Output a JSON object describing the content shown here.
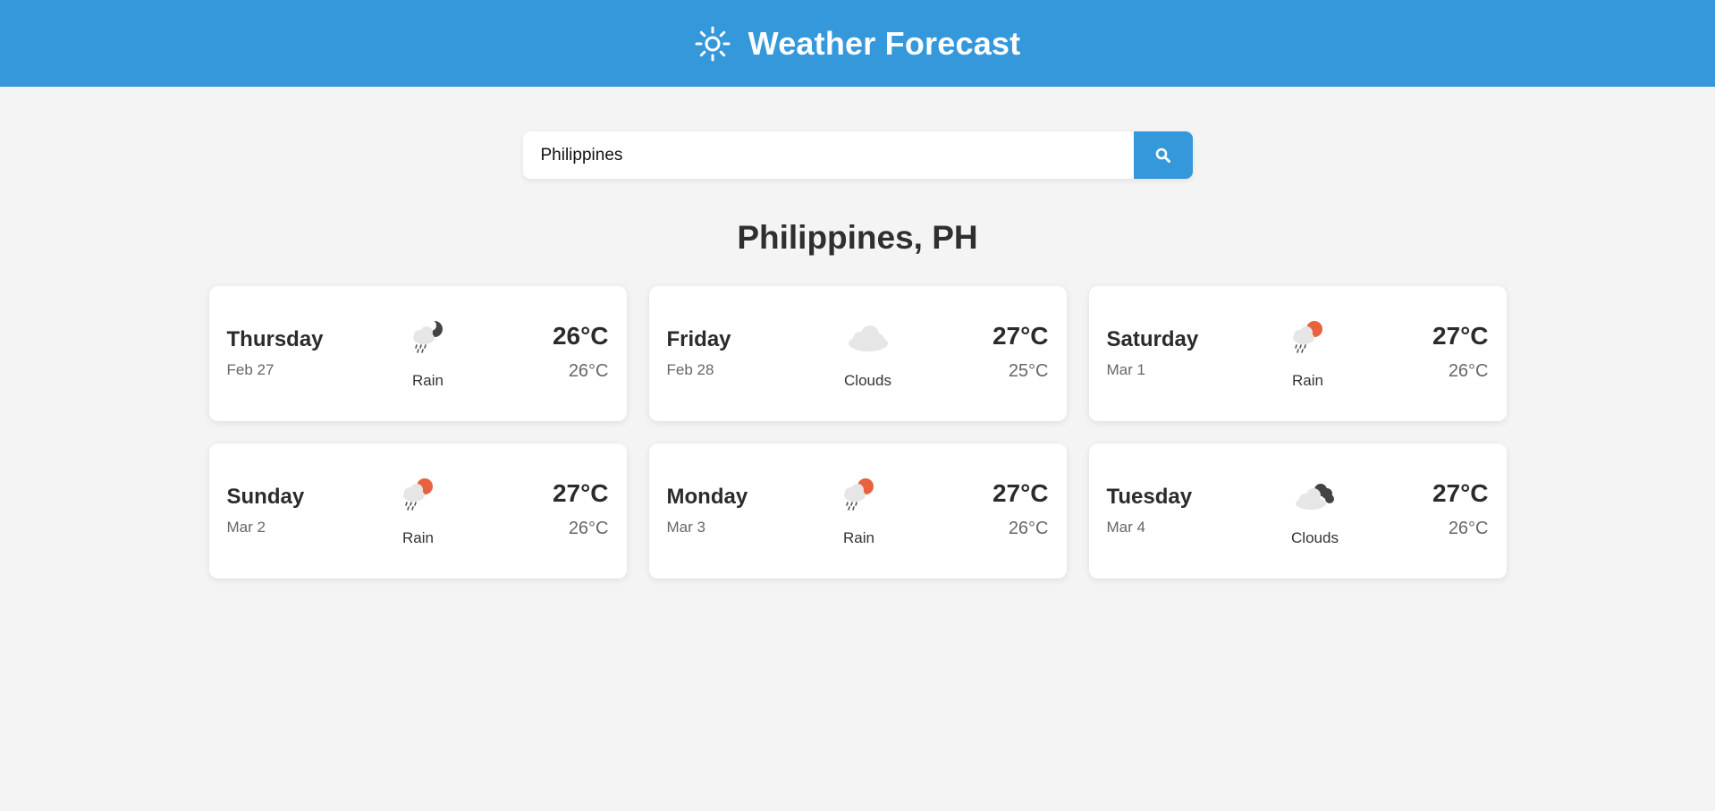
{
  "header": {
    "title": "Weather Forecast",
    "icon": "sun-icon"
  },
  "search": {
    "value": "Philippines",
    "placeholder": "",
    "button_icon": "search-icon"
  },
  "location": "Philippines, PH",
  "colors": {
    "accent": "#3498db",
    "background": "#f4f4f4",
    "sun_orange": "#e8623f",
    "moon_dark": "#444444"
  },
  "forecast": [
    {
      "day": "Thursday",
      "date": "Feb 27",
      "condition": "Rain",
      "icon": "rain-night-icon",
      "high": "26°C",
      "low": "26°C"
    },
    {
      "day": "Friday",
      "date": "Feb 28",
      "condition": "Clouds",
      "icon": "cloud-icon",
      "high": "27°C",
      "low": "25°C"
    },
    {
      "day": "Saturday",
      "date": "Mar 1",
      "condition": "Rain",
      "icon": "rain-sun-icon",
      "high": "27°C",
      "low": "26°C"
    },
    {
      "day": "Sunday",
      "date": "Mar 2",
      "condition": "Rain",
      "icon": "rain-sun-icon",
      "high": "27°C",
      "low": "26°C"
    },
    {
      "day": "Monday",
      "date": "Mar 3",
      "condition": "Rain",
      "icon": "rain-sun-icon",
      "high": "27°C",
      "low": "26°C"
    },
    {
      "day": "Tuesday",
      "date": "Mar 4",
      "condition": "Clouds",
      "icon": "broken-clouds-icon",
      "high": "27°C",
      "low": "26°C"
    }
  ]
}
